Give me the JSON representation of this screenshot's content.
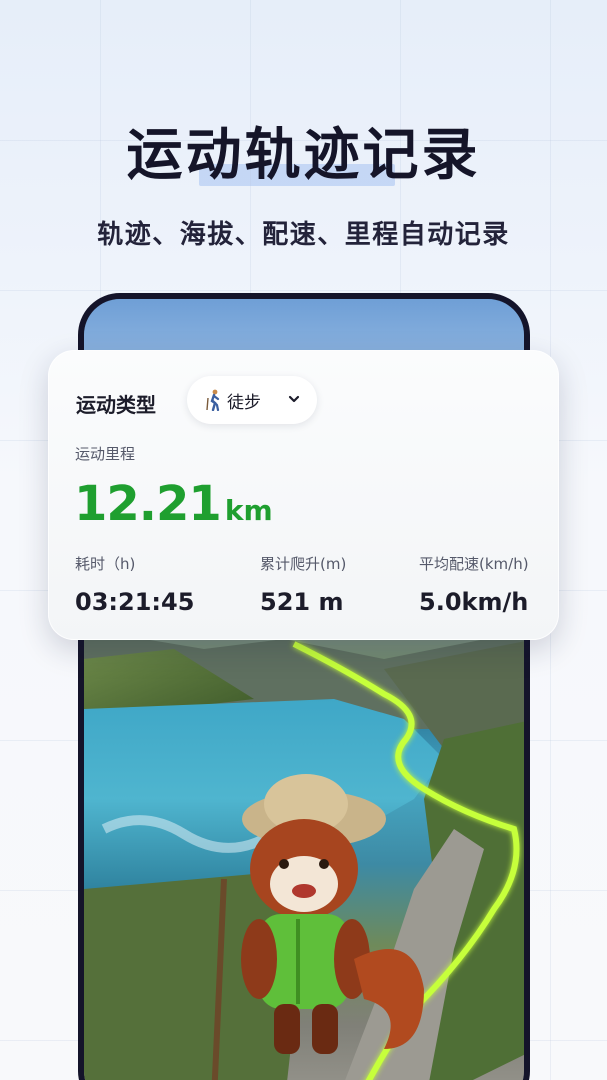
{
  "hero": {
    "title": "运动轨迹记录",
    "subtitle": "轨迹、海拔、配速、里程自动记录"
  },
  "card": {
    "sport_type_label": "运动类型",
    "sport_type": {
      "icon": "walker-icon",
      "value": "徒步"
    },
    "distance": {
      "label": "运动里程",
      "value": "12.21",
      "unit": "km",
      "color": "#1f9f2f"
    },
    "stats": [
      {
        "label": "耗时（h)",
        "value": "03:21:45"
      },
      {
        "label": "累计爬升(m)",
        "value": "521 m"
      },
      {
        "label": "平均配速(km/h)",
        "value": "5.0km/h"
      }
    ]
  },
  "colors": {
    "accent_green": "#1f9f2f",
    "track_green": "#b8ff2a",
    "title_dark": "#151529"
  }
}
